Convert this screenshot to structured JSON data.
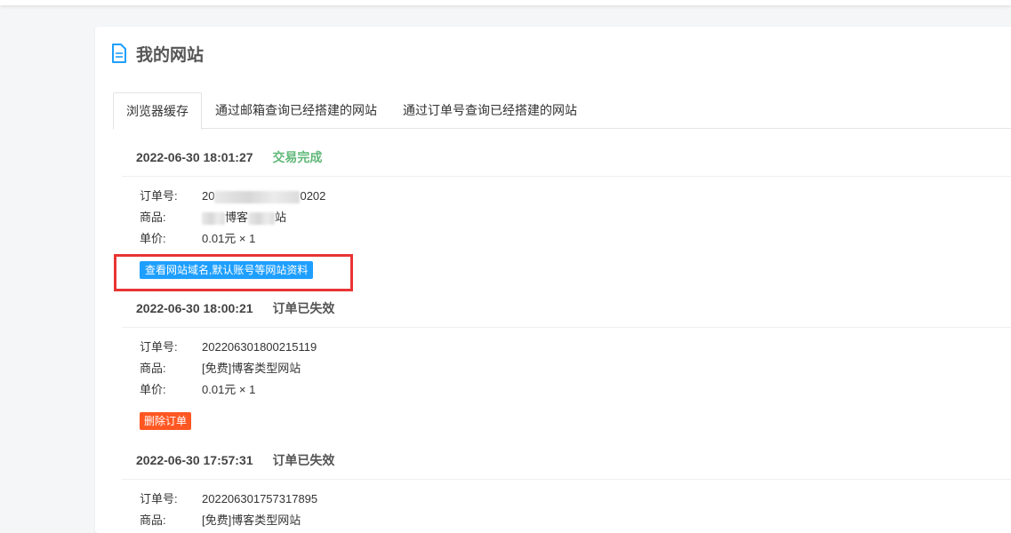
{
  "page": {
    "title": "我的网站"
  },
  "tabs": [
    {
      "label": "浏览器缓存",
      "active": true
    },
    {
      "label": "通过邮箱查询已经搭建的网站",
      "active": false
    },
    {
      "label": "通过订单号查询已经搭建的网站",
      "active": false
    }
  ],
  "labels": {
    "order_no": "订单号:",
    "product": "商品:",
    "price": "单价:"
  },
  "orders": [
    {
      "time": "2022-06-30 18:01:27",
      "status": "交易完成",
      "order_no_visible_start": "20",
      "order_no_visible_end": "0202",
      "product_visible": "博客",
      "product_visible_end": "站",
      "price": "0.01元 × 1",
      "action": "查看网站域名,默认账号等网站资料"
    },
    {
      "time": "2022-06-30 18:00:21",
      "status": "订单已失效",
      "order_no": "202206301800215119",
      "product": "[免费]博客类型网站",
      "price": "0.01元 × 1",
      "action": "删除订单"
    },
    {
      "time": "2022-06-30 17:57:31",
      "status": "订单已失效",
      "order_no": "202206301757317895",
      "product": "[免费]博客类型网站"
    }
  ],
  "colors": {
    "success": "#5fb878",
    "primary_button": "#1e9fff",
    "danger_button": "#ff5722",
    "highlight_box": "#e93434"
  },
  "icons": {
    "title_icon": "document-icon"
  }
}
